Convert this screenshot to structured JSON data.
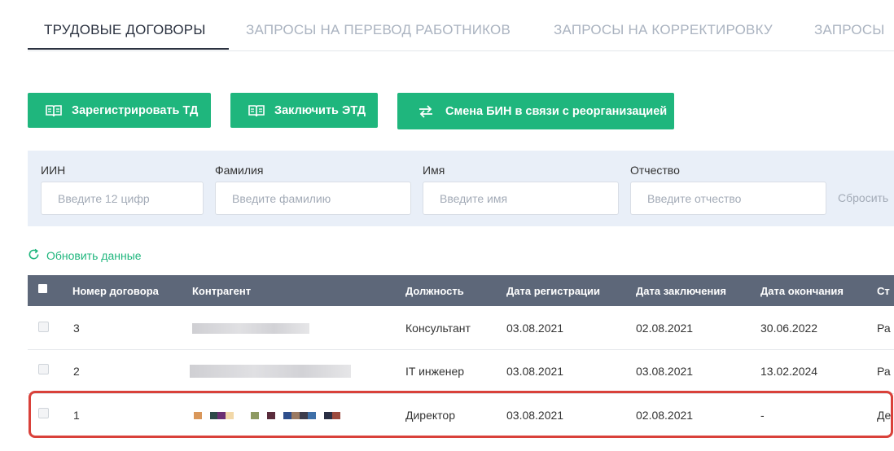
{
  "tabs": [
    {
      "label": "ТРУДОВЫЕ ДОГОВОРЫ",
      "active": true
    },
    {
      "label": "ЗАПРОСЫ НА ПЕРЕВОД РАБОТНИКОВ",
      "active": false
    },
    {
      "label": "ЗАПРОСЫ НА КОРРЕКТИРОВКУ",
      "active": false
    },
    {
      "label": "ЗАПРОСЫ",
      "active": false
    }
  ],
  "actions": {
    "register_label": "Зарегистрировать ТД",
    "conclude_label": "Заключить ЭТД",
    "change_bin_label": "Смена БИН в связи с реорганизацией"
  },
  "filters": {
    "iin_label": "ИИН",
    "iin_placeholder": "Введите 12 цифр",
    "surname_label": "Фамилия",
    "surname_placeholder": "Введите фамилию",
    "name_label": "Имя",
    "name_placeholder": "Введите имя",
    "patronymic_label": "Отчество",
    "patronymic_placeholder": "Введите отчество",
    "reset_label": "Сбросить"
  },
  "refresh_label": "Обновить данные",
  "table": {
    "columns": [
      "Номер договора",
      "Контрагент",
      "Должность",
      "Дата регистрации",
      "Дата заключения",
      "Дата окончания",
      "Ст"
    ],
    "rows": [
      {
        "number": "3",
        "position": "Консультант",
        "registered": "03.08.2021",
        "concluded": "02.08.2021",
        "ends": "30.06.2022",
        "status": "Ра"
      },
      {
        "number": "2",
        "position": "IT инженер",
        "registered": "03.08.2021",
        "concluded": "03.08.2021",
        "ends": "13.02.2024",
        "status": "Ра"
      },
      {
        "number": "1",
        "position": "Директор",
        "registered": "03.08.2021",
        "concluded": "02.08.2021",
        "ends": "-",
        "status": "Де"
      }
    ]
  },
  "colors": {
    "accent": "#1fb67d",
    "header": "#5d6779",
    "highlight": "#d9413a"
  },
  "icons": {
    "register": "book-icon",
    "conclude": "book-icon",
    "change_bin": "swap-arrows-icon",
    "refresh": "refresh-icon"
  }
}
